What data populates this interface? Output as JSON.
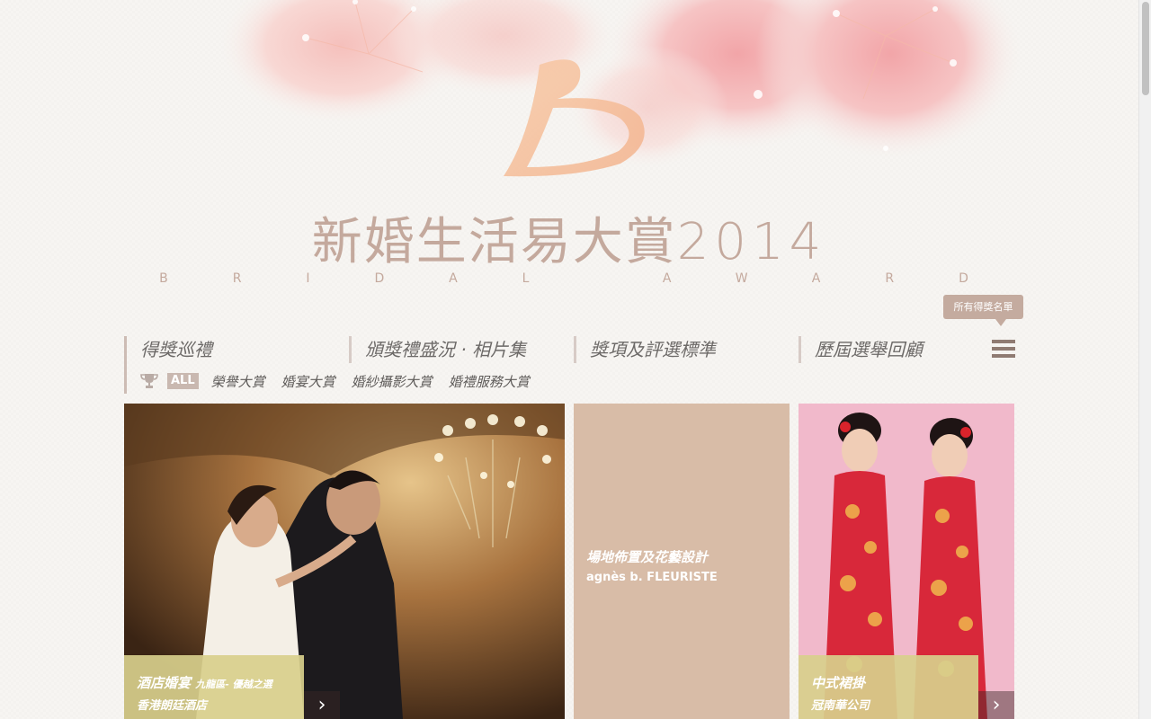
{
  "header": {
    "title_zh": "新婚生活易大賞",
    "title_year": "2014",
    "title_en": "BRIDAL AWARD"
  },
  "tooltip": {
    "label": "所有得獎名單"
  },
  "nav": {
    "items": [
      {
        "label": "得獎巡禮"
      },
      {
        "label": "頒獎禮盛況 · 相片集"
      },
      {
        "label": "獎項及評選標準"
      },
      {
        "label": "歷屆選舉回顧"
      }
    ],
    "menu_icon": "hamburger-menu-icon"
  },
  "subnav": {
    "icon": "trophy-icon",
    "active": "ALL",
    "items": [
      {
        "label": "榮譽大賞"
      },
      {
        "label": "婚宴大賞"
      },
      {
        "label": "婚紗攝影大賞"
      },
      {
        "label": "婚禮服務大賞"
      }
    ]
  },
  "tiles": [
    {
      "caption_title": "酒店婚宴",
      "caption_tag": "九龍區- 優越之選",
      "caption_sub": "香港朗廷酒店",
      "arrow": "›"
    },
    {
      "title": "場地佈置及花藝設計",
      "subtitle": "agnès b. FLEURISTE",
      "color": "#d8bca7"
    },
    {
      "caption_title": "中式裙掛",
      "caption_sub": "冠南華公司",
      "arrow": "›"
    }
  ],
  "colors": {
    "brand": "#c4a99d",
    "caption_bg": "#d8cf8c",
    "tile_bg": "#d8bca7"
  }
}
